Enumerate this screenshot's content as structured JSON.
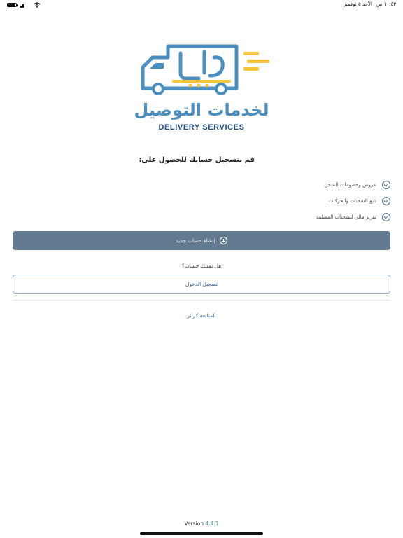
{
  "status_bar": {
    "time": "١٠:٤٣ ص",
    "date": "الأحد ٥ نوفمبر"
  },
  "logo": {
    "arabic_title": "لخدمات التوصيل",
    "english_title": "DELIVERY SERVICES",
    "colors": {
      "blue": "#4b8ec0",
      "yellow": "#f5c53a",
      "navy": "#1f4f86"
    }
  },
  "intro": {
    "title": "قم بتسجيل حسابك للحصول على:"
  },
  "benefits": [
    {
      "label": "عروض وخصومات للشحن"
    },
    {
      "label": "تتبع الشحنات والحركات"
    },
    {
      "label": "تقرير مالي للشحنات المسلمة"
    }
  ],
  "actions": {
    "create_account": "إنشاء حساب جديد",
    "have_account": "هل تمتلك حساب؟",
    "login": "تسجيل الدخول",
    "continue_guest": "المتابعة كزائر"
  },
  "footer": {
    "version_label": "Version",
    "version_number": "4.4.1"
  },
  "theme": {
    "primary_button": "#627b90",
    "link": "#2f5c89",
    "version_accent": "#3ba68e"
  }
}
